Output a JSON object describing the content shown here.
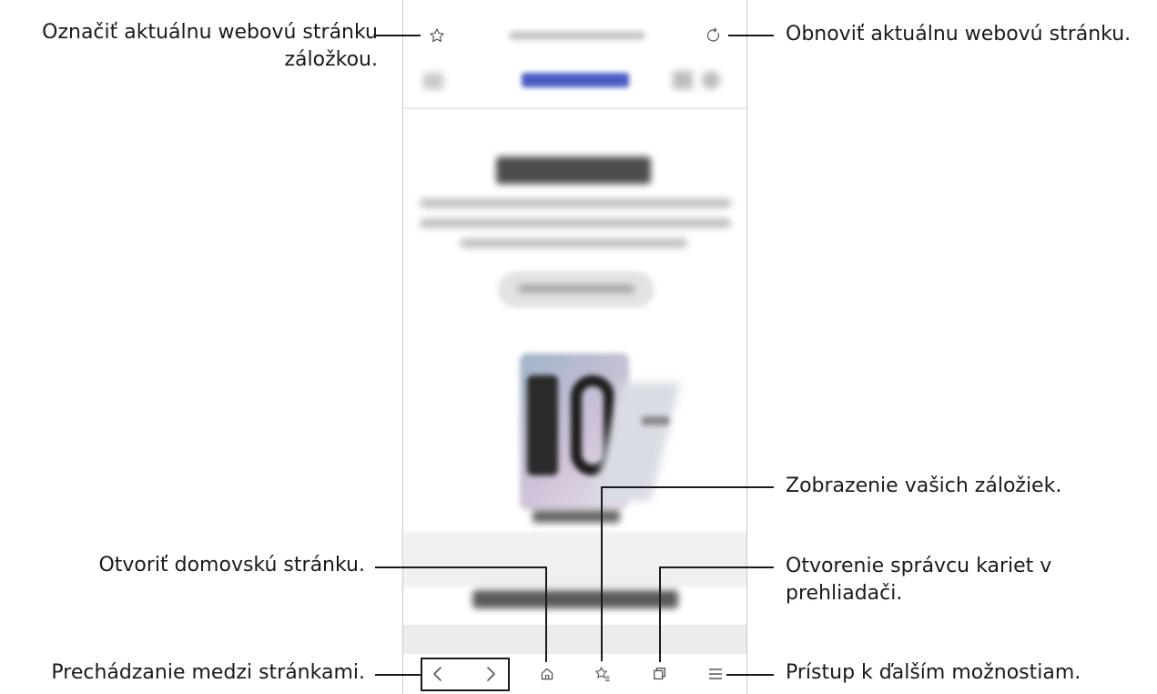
{
  "callouts": {
    "bookmark_line1": "Označiť aktuálnu webovú stránku",
    "bookmark_line2": "záložkou.",
    "refresh": "Obnoviť aktuálnu webovú stránku.",
    "view_bookmarks": "Zobrazenie vašich záložiek.",
    "home": "Otvoriť domovskú stránku.",
    "tabs_line1": "Otvorenie správcu kariet v",
    "tabs_line2": "prehliadači.",
    "navigate": "Prechádzanie medzi stránkami.",
    "more": "Prístup k ďalším možnostiam."
  },
  "colors": {
    "accent": "#1a1a1a",
    "nav_highlight": "#3a4a9c"
  },
  "icons": [
    "star-outline-icon",
    "refresh-icon",
    "back-icon",
    "forward-icon",
    "home-icon",
    "bookmarks-icon",
    "tabs-icon",
    "menu-icon"
  ]
}
